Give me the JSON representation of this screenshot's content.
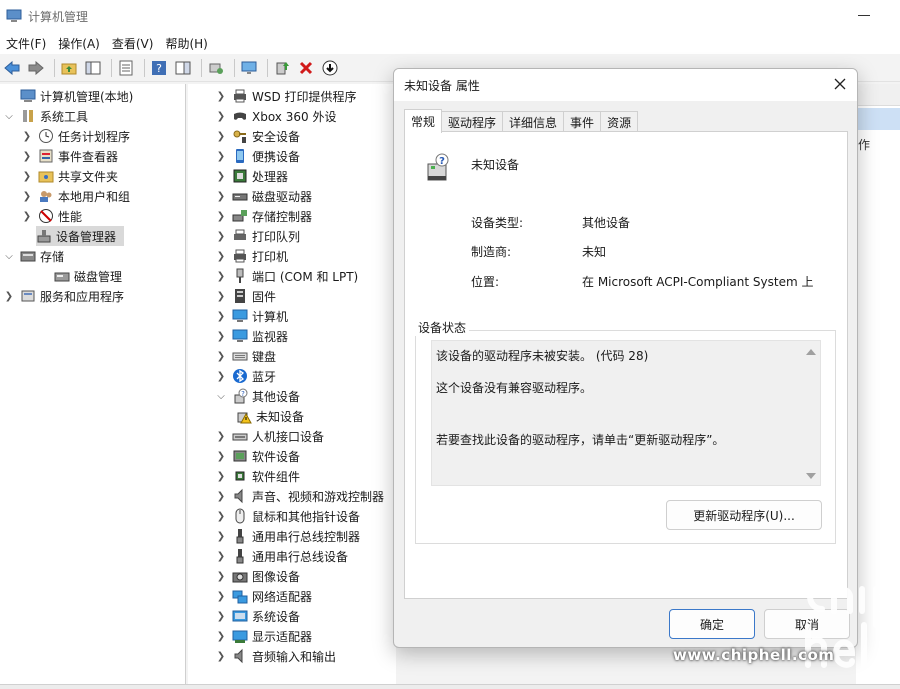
{
  "window": {
    "title": "计算机管理"
  },
  "menu": [
    "文件(F)",
    "操作(A)",
    "查看(V)",
    "帮助(H)"
  ],
  "left_tree": [
    {
      "label": "计算机管理(本地)",
      "indent": 0,
      "chev": "",
      "icon": "computer-management-icon"
    },
    {
      "label": "系统工具",
      "indent": 1,
      "chev": "v",
      "icon": "system-tools-icon"
    },
    {
      "label": "任务计划程序",
      "indent": 2,
      "chev": ">",
      "icon": "clock-icon"
    },
    {
      "label": "事件查看器",
      "indent": 2,
      "chev": ">",
      "icon": "event-viewer-icon"
    },
    {
      "label": "共享文件夹",
      "indent": 2,
      "chev": ">",
      "icon": "shared-folder-icon"
    },
    {
      "label": "本地用户和组",
      "indent": 2,
      "chev": ">",
      "icon": "users-icon"
    },
    {
      "label": "性能",
      "indent": 2,
      "chev": ">",
      "icon": "performance-icon"
    },
    {
      "label": "设备管理器",
      "indent": 2,
      "chev": "",
      "icon": "device-manager-icon",
      "selected": true
    },
    {
      "label": "存储",
      "indent": 1,
      "chev": "v",
      "icon": "storage-icon"
    },
    {
      "label": "磁盘管理",
      "indent": 2,
      "chev": "",
      "icon": "disk-management-icon"
    },
    {
      "label": "服务和应用程序",
      "indent": 1,
      "chev": ">",
      "icon": "services-icon"
    }
  ],
  "device_tree": [
    {
      "label": "WSD 打印提供程序",
      "chev": ">",
      "icon": "printer-icon"
    },
    {
      "label": "Xbox 360 外设",
      "chev": ">",
      "icon": "gamepad-icon"
    },
    {
      "label": "安全设备",
      "chev": ">",
      "icon": "security-key-icon"
    },
    {
      "label": "便携设备",
      "chev": ">",
      "icon": "portable-device-icon"
    },
    {
      "label": "处理器",
      "chev": ">",
      "icon": "processor-icon"
    },
    {
      "label": "磁盘驱动器",
      "chev": ">",
      "icon": "disk-drive-icon"
    },
    {
      "label": "存储控制器",
      "chev": ">",
      "icon": "storage-controller-icon"
    },
    {
      "label": "打印队列",
      "chev": ">",
      "icon": "print-queue-icon"
    },
    {
      "label": "打印机",
      "chev": ">",
      "icon": "printer-icon"
    },
    {
      "label": "端口 (COM 和 LPT)",
      "chev": ">",
      "icon": "port-icon"
    },
    {
      "label": "固件",
      "chev": ">",
      "icon": "firmware-icon"
    },
    {
      "label": "计算机",
      "chev": ">",
      "icon": "computer-icon"
    },
    {
      "label": "监视器",
      "chev": ">",
      "icon": "monitor-icon"
    },
    {
      "label": "键盘",
      "chev": ">",
      "icon": "keyboard-icon"
    },
    {
      "label": "蓝牙",
      "chev": ">",
      "icon": "bluetooth-icon"
    },
    {
      "label": "其他设备",
      "chev": "v",
      "icon": "other-devices-icon"
    },
    {
      "label": "未知设备",
      "chev": "",
      "icon": "unknown-device-warning-icon",
      "child": true
    },
    {
      "label": "人机接口设备",
      "chev": ">",
      "icon": "hid-icon"
    },
    {
      "label": "软件设备",
      "chev": ">",
      "icon": "software-device-icon"
    },
    {
      "label": "软件组件",
      "chev": ">",
      "icon": "software-component-icon"
    },
    {
      "label": "声音、视频和游戏控制器",
      "chev": ">",
      "icon": "speaker-icon"
    },
    {
      "label": "鼠标和其他指针设备",
      "chev": ">",
      "icon": "mouse-icon"
    },
    {
      "label": "通用串行总线控制器",
      "chev": ">",
      "icon": "usb-icon"
    },
    {
      "label": "通用串行总线设备",
      "chev": ">",
      "icon": "usb-icon"
    },
    {
      "label": "图像设备",
      "chev": ">",
      "icon": "camera-icon"
    },
    {
      "label": "网络适配器",
      "chev": ">",
      "icon": "network-adapter-icon"
    },
    {
      "label": "系统设备",
      "chev": ">",
      "icon": "system-device-icon"
    },
    {
      "label": "显示适配器",
      "chev": ">",
      "icon": "display-adapter-icon"
    },
    {
      "label": "音频输入和输出",
      "chev": ">",
      "icon": "audio-io-icon"
    }
  ],
  "right_strip": {
    "text": "作"
  },
  "dialog": {
    "title": "未知设备 属性",
    "tabs": [
      "常规",
      "驱动程序",
      "详细信息",
      "事件",
      "资源"
    ],
    "device_name": "未知设备",
    "props": [
      {
        "label": "设备类型:",
        "value": "其他设备"
      },
      {
        "label": "制造商:",
        "value": "未知"
      },
      {
        "label": "位置:",
        "value": "在 Microsoft ACPI-Compliant System 上"
      }
    ],
    "status_group_title": "设备状态",
    "status_lines": [
      "该设备的驱动程序未被安装。 (代码 28)",
      "这个设备没有兼容驱动程序。",
      "若要查找此设备的驱动程序，请单击“更新驱动程序”。"
    ],
    "update_driver_button": "更新驱动程序(U)...",
    "ok_button": "确定",
    "cancel_button": "取消"
  },
  "watermark": "www.chiphell.com",
  "colors": {
    "selection": "#cde0f5",
    "tree_selected": "#d9d9d9",
    "primary_border": "#3b78c9"
  }
}
